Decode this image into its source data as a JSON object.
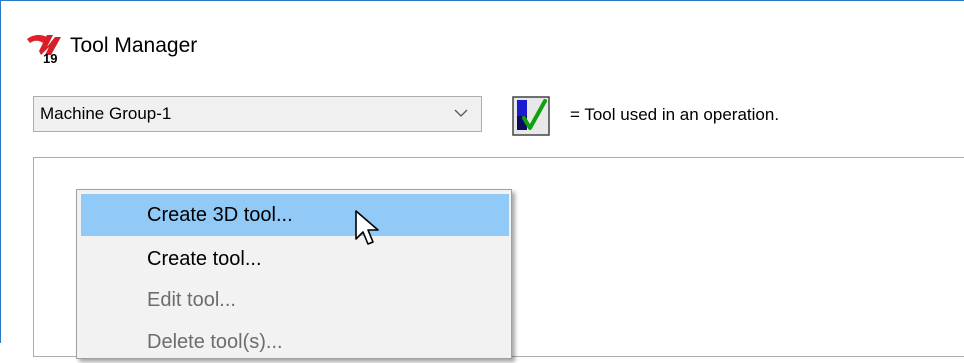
{
  "window": {
    "title": "Tool Manager",
    "app_icon": "mastercam-19-icon"
  },
  "toolbar": {
    "group_select": {
      "value": "Machine Group-1",
      "icon": "chevron-down-icon"
    },
    "legend": {
      "icon": "tool-used-checkmark-icon",
      "text": "= Tool used in an operation."
    }
  },
  "context_menu": {
    "items": [
      {
        "label": "Create 3D tool...",
        "state": "highlighted"
      },
      {
        "label": "Create tool...",
        "state": "enabled"
      },
      {
        "label": "Edit tool...",
        "state": "disabled"
      },
      {
        "label": "Delete tool(s)...",
        "state": "disabled"
      }
    ]
  },
  "colors": {
    "accent": "#2b79c6",
    "menu_highlight": "#91c9f7",
    "disabled_text": "#6d6d6d"
  }
}
